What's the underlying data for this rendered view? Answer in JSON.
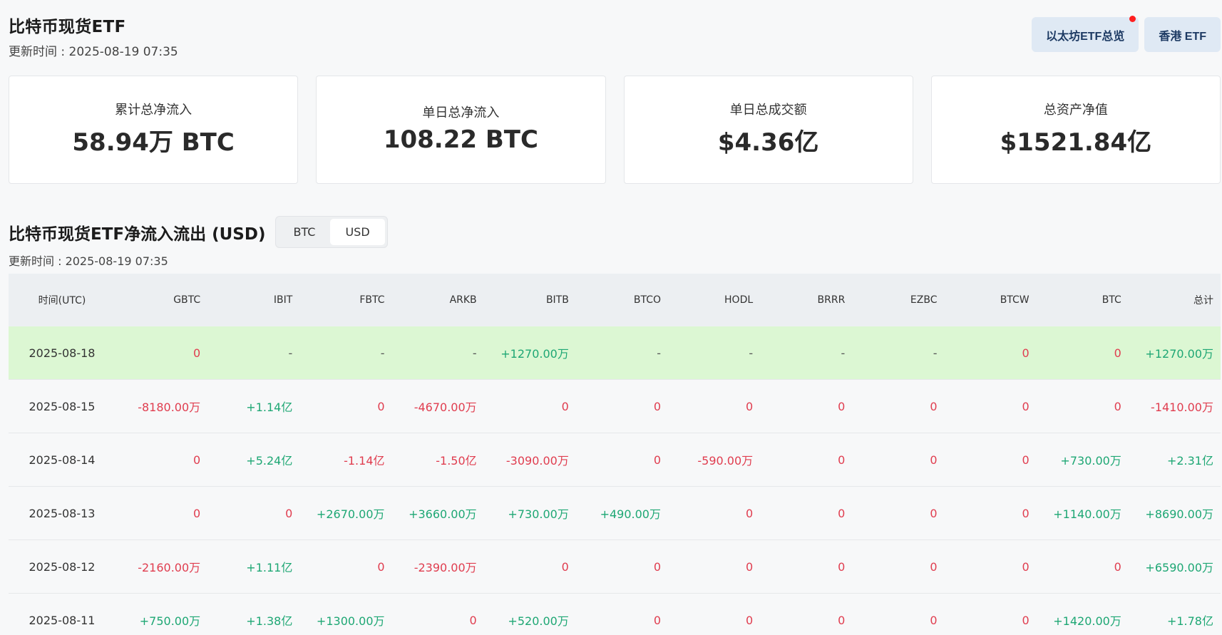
{
  "header": {
    "title": "比特币现货ETF",
    "update_time": "更新时间 : 2025-08-19 07:35"
  },
  "top_buttons": {
    "eth_overview": "以太坊ETF总览",
    "hk_etf": "香港 ETF"
  },
  "stats": [
    {
      "label": "累计总净流入",
      "value": "58.94万 BTC"
    },
    {
      "label": "单日总净流入",
      "value": "108.22 BTC"
    },
    {
      "label": "单日总成交额",
      "value": "$4.36亿"
    },
    {
      "label": "总资产净值",
      "value": "$1521.84亿"
    }
  ],
  "flows": {
    "title": "比特币现货ETF净流入流出 (USD)",
    "toggle": {
      "btc": "BTC",
      "usd": "USD",
      "selected": "USD"
    },
    "update_time": "更新时间 : 2025-08-19 07:35"
  },
  "colors": {
    "positive": "#1ea774",
    "negative": "#e03d4f",
    "highlight_row": "#dcf7d3"
  },
  "table": {
    "headers": [
      "时间(UTC)",
      "GBTC",
      "IBIT",
      "FBTC",
      "ARKB",
      "BITB",
      "BTCO",
      "HODL",
      "BRRR",
      "EZBC",
      "BTCW",
      "BTC",
      "总计"
    ],
    "rows": [
      [
        "2025-08-18",
        "0",
        "-",
        "-",
        "-",
        "+1270.00万",
        "-",
        "-",
        "-",
        "-",
        "0",
        "0",
        "+1270.00万"
      ],
      [
        "2025-08-15",
        "-8180.00万",
        "+1.14亿",
        "0",
        "-4670.00万",
        "0",
        "0",
        "0",
        "0",
        "0",
        "0",
        "0",
        "-1410.00万"
      ],
      [
        "2025-08-14",
        "0",
        "+5.24亿",
        "-1.14亿",
        "-1.50亿",
        "-3090.00万",
        "0",
        "-590.00万",
        "0",
        "0",
        "0",
        "+730.00万",
        "+2.31亿"
      ],
      [
        "2025-08-13",
        "0",
        "0",
        "+2670.00万",
        "+3660.00万",
        "+730.00万",
        "+490.00万",
        "0",
        "0",
        "0",
        "0",
        "+1140.00万",
        "+8690.00万"
      ],
      [
        "2025-08-12",
        "-2160.00万",
        "+1.11亿",
        "0",
        "-2390.00万",
        "0",
        "0",
        "0",
        "0",
        "0",
        "0",
        "0",
        "+6590.00万"
      ],
      [
        "2025-08-11",
        "+750.00万",
        "+1.38亿",
        "+1300.00万",
        "0",
        "+520.00万",
        "0",
        "0",
        "0",
        "0",
        "0",
        "+1420.00万",
        "+1.78亿"
      ]
    ]
  }
}
